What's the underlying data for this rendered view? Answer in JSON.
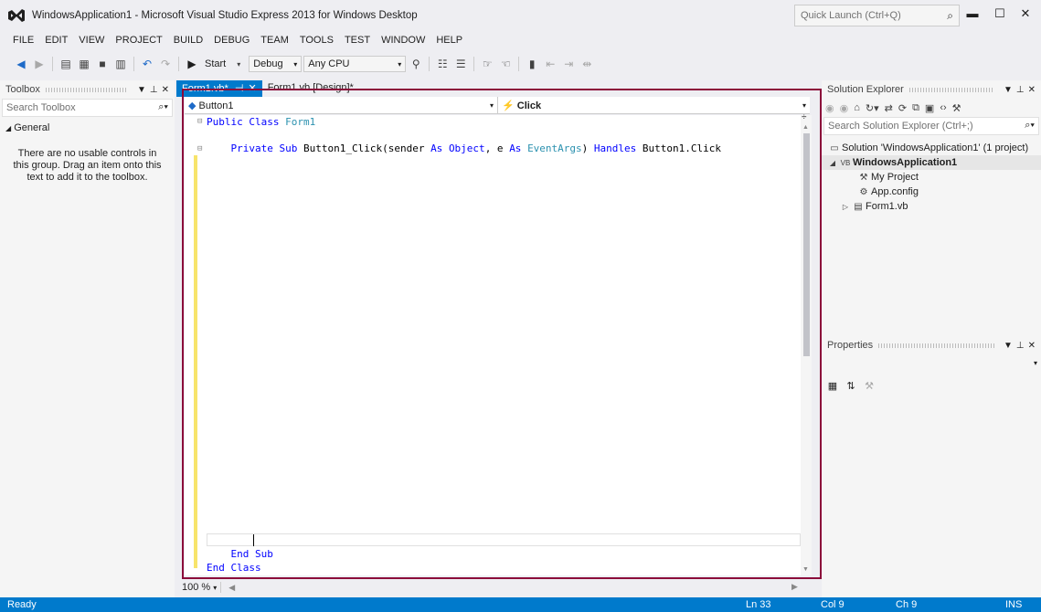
{
  "titlebar": {
    "title": "WindowsApplication1 - Microsoft Visual Studio Express 2013 for Windows Desktop",
    "quick_launch_placeholder": "Quick Launch (Ctrl+Q)",
    "minimize": "▬",
    "maximize": "☐",
    "close": "✕"
  },
  "menu": [
    "FILE",
    "EDIT",
    "VIEW",
    "PROJECT",
    "BUILD",
    "DEBUG",
    "TEAM",
    "TOOLS",
    "TEST",
    "WINDOW",
    "HELP"
  ],
  "toolbar": {
    "start_label": "Start",
    "config": "Debug",
    "platform": "Any CPU"
  },
  "toolbox": {
    "title": "Toolbox",
    "search_placeholder": "Search Toolbox",
    "group": "General",
    "empty_message": "There are no usable controls in this group. Drag an item onto this text to add it to the toolbox."
  },
  "tabs": {
    "active": "Form1.vb*",
    "inactive": "Form1.vb [Design]*"
  },
  "navbar": {
    "object": "Button1",
    "event": "Click"
  },
  "code": {
    "line1_kw": "Public Class",
    "line1_name": "Form1",
    "line2_kw1": "Private Sub",
    "line2_name": "Button1_Click(sender",
    "line2_as1": "As",
    "line2_t1": "Object",
    "line2_e": ", e",
    "line2_as2": "As",
    "line2_t2": "EventArgs",
    "line2_handles": "Handles",
    "line2_rest": "Button1.Click",
    "end_sub": "End Sub",
    "end_class": "End Class"
  },
  "zoom": "100 %",
  "solution_explorer": {
    "title": "Solution Explorer",
    "search_placeholder": "Search Solution Explorer (Ctrl+;)",
    "items": [
      {
        "label": "Solution 'WindowsApplication1' (1 project)"
      },
      {
        "label": "WindowsApplication1"
      },
      {
        "label": "My Project"
      },
      {
        "label": "App.config"
      },
      {
        "label": "Form1.vb"
      }
    ]
  },
  "properties": {
    "title": "Properties"
  },
  "status": {
    "state": "Ready",
    "line": "Ln 33",
    "col": "Col 9",
    "ch": "Ch 9",
    "mode": "INS"
  }
}
